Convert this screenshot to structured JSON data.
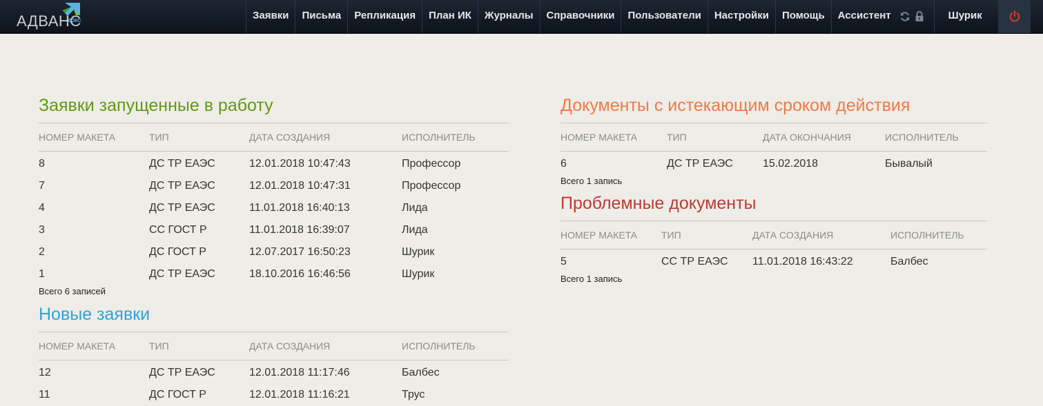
{
  "app": {
    "brand": "АДВАНС",
    "brand_sub": "ДОКС"
  },
  "nav": {
    "items": [
      "Заявки",
      "Письма",
      "Репликация",
      "План ИК",
      "Журналы",
      "Справочники",
      "Пользователи",
      "Настройки",
      "Помощь",
      "Ассистент"
    ],
    "refresh_icon": "refresh-icon",
    "lock_icon": "lock-icon",
    "user": "Шурик",
    "power_icon": "power-icon"
  },
  "colors": {
    "in_work_title": "#5f9a12",
    "new_title": "#2ea3d8",
    "expiring_title": "#f07a46",
    "problem_title": "#b93c36"
  },
  "in_work": {
    "title": "Заявки запущенные в работу",
    "columns": [
      "Номер макета",
      "Тип",
      "Дата создания",
      "Исполнитель"
    ],
    "rows": [
      [
        "8",
        "ДС ТР ЕАЭС",
        "12.01.2018 10:47:43",
        "Профессор"
      ],
      [
        "7",
        "ДС ТР ЕАЭС",
        "12.01.2018 10:47:31",
        "Профессор"
      ],
      [
        "4",
        "ДС ТР ЕАЭС",
        "11.01.2018 16:40:13",
        "Лида"
      ],
      [
        "3",
        "СС ГОСТ Р",
        "11.01.2018 16:39:07",
        "Лида"
      ],
      [
        "2",
        "ДС ГОСТ Р",
        "12.07.2017 16:50:23",
        "Шурик"
      ],
      [
        "1",
        "ДС ТР ЕАЭС",
        "18.10.2016 16:46:56",
        "Шурик"
      ]
    ],
    "total": "Всего 6 записей"
  },
  "new_requests": {
    "title": "Новые заявки",
    "columns": [
      "Номер макета",
      "Тип",
      "Дата создания",
      "Исполнитель"
    ],
    "rows": [
      [
        "12",
        "ДС ТР ЕАЭС",
        "12.01.2018 11:17:46",
        "Балбес"
      ],
      [
        "11",
        "ДС ГОСТ Р",
        "12.01.2018 11:16:21",
        "Трус"
      ]
    ]
  },
  "expiring": {
    "title": "Документы с истекающим сроком действия",
    "columns": [
      "Номер макета",
      "Тип",
      "Дата окончания",
      "Исполнитель"
    ],
    "rows": [
      [
        "6",
        "ДС ТР ЕАЭС",
        "15.02.2018",
        "Бывалый"
      ]
    ],
    "total": "Всего 1 запись"
  },
  "problem": {
    "title": "Проблемные документы",
    "columns": [
      "Номер макета",
      "Тип",
      "Дата создания",
      "Исполнитель"
    ],
    "rows": [
      [
        "5",
        "СС ТР ЕАЭС",
        "11.01.2018 16:43:22",
        "Балбес"
      ]
    ],
    "total": "Всего 1 запись"
  }
}
